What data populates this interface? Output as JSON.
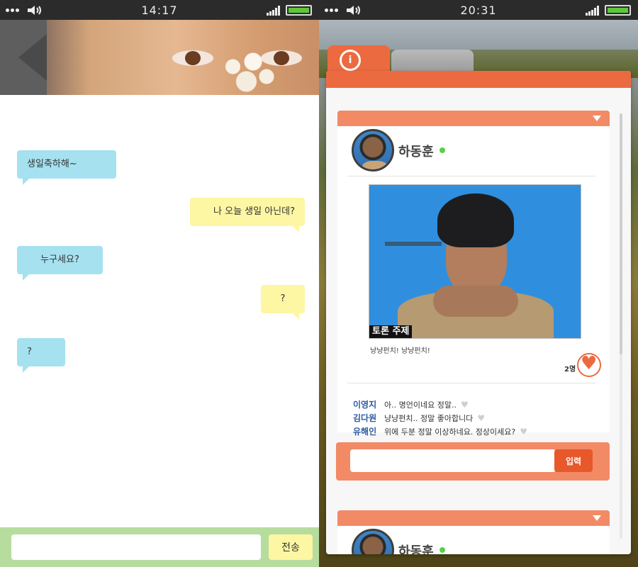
{
  "left": {
    "status": {
      "time": "14:17"
    },
    "messages": [
      {
        "from": "them",
        "text": "생일축하해~"
      },
      {
        "from": "me",
        "text": "나 오늘 생일 아닌데?"
      },
      {
        "from": "them",
        "text": "누구세요?"
      },
      {
        "from": "me",
        "text": "?"
      },
      {
        "from": "them",
        "text": "?"
      }
    ],
    "composer": {
      "value": "",
      "send_label": "전송"
    }
  },
  "right": {
    "status": {
      "time": "20:31"
    },
    "logo": "i",
    "post": {
      "author": "하동훈",
      "photo_caption": "토론 주제",
      "text": "냥냥펀치! 냥냥펀치!",
      "likes": "2명"
    },
    "comments": [
      {
        "name": "이영지",
        "text": "아.. 명언이네요 정말.."
      },
      {
        "name": "김다원",
        "text": "냥냥펀치.. 정말 좋아합니다"
      },
      {
        "name": "유해인",
        "text": "위에 두분 정말 이상하네요. 정상이세요?"
      }
    ],
    "reply": {
      "value": "",
      "submit_label": "입력"
    },
    "next_post": {
      "author": "하동훈"
    }
  },
  "colors": {
    "accent": "#ec6a40",
    "bubble_them": "#a6e1f0",
    "bubble_me": "#fdf6a3",
    "composer_bg": "#b6dc9e",
    "online": "#58d04a"
  },
  "icons": [
    "speaker-icon",
    "signal-icon",
    "battery-icon",
    "heart-icon",
    "caret-down-icon",
    "logo-icon"
  ]
}
